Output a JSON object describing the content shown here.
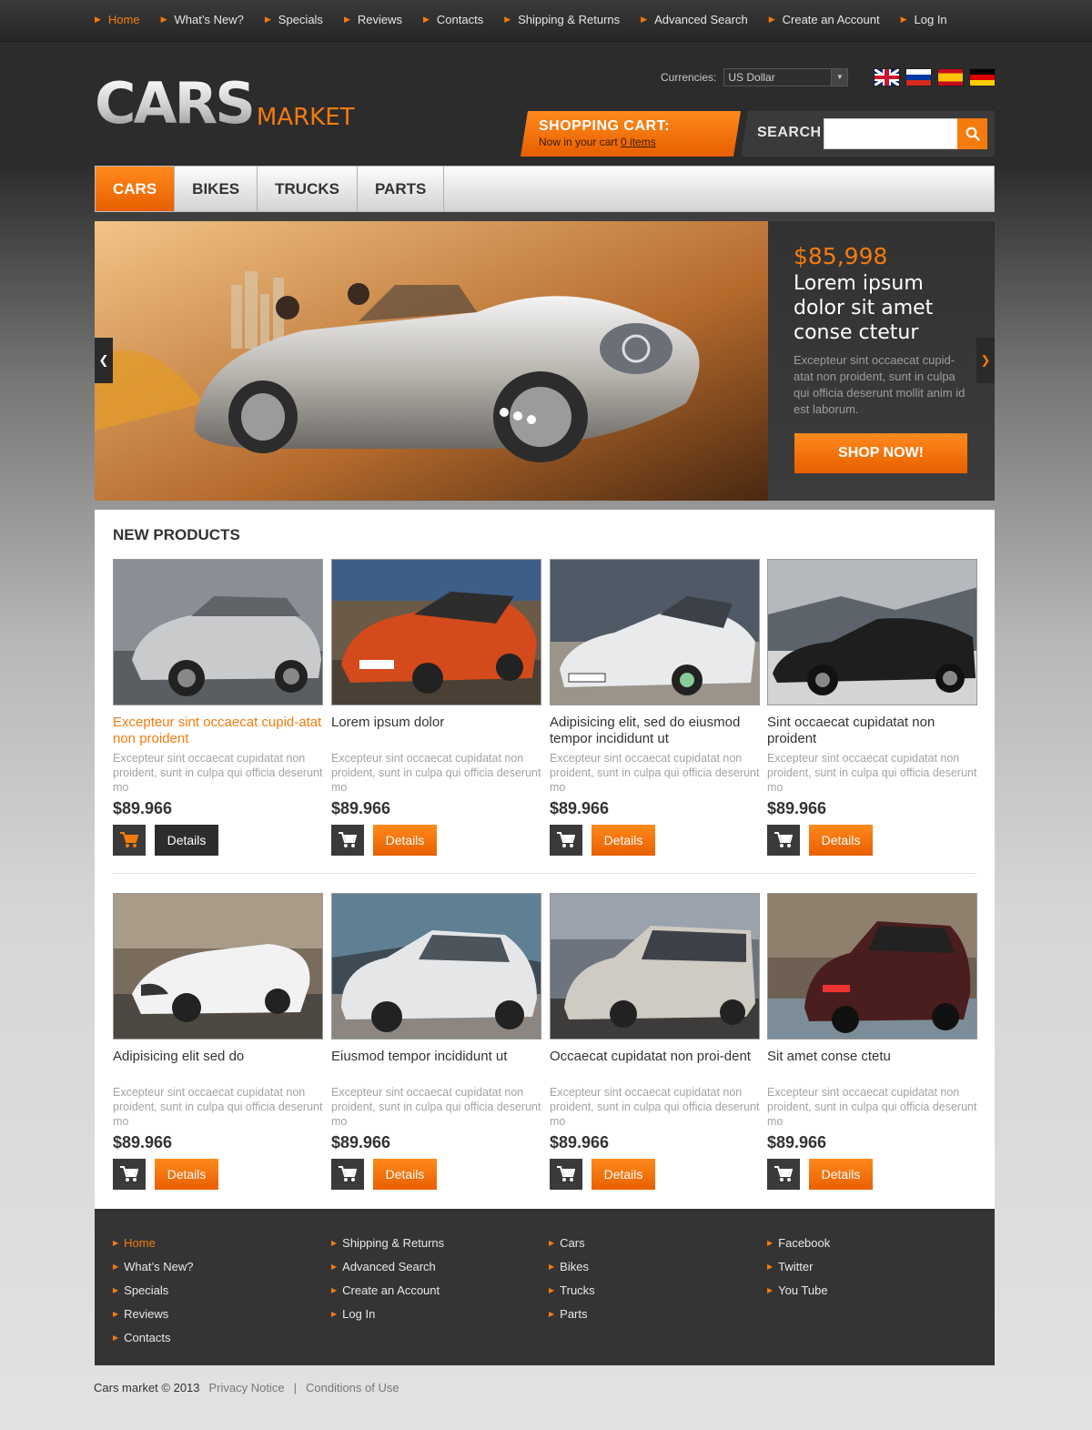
{
  "top_nav": [
    {
      "label": "Home",
      "active": true
    },
    {
      "label": "What’s New?"
    },
    {
      "label": "Specials"
    },
    {
      "label": "Reviews"
    },
    {
      "label": "Contacts"
    },
    {
      "label": "Shipping & Returns"
    },
    {
      "label": "Advanced Search"
    },
    {
      "label": "Create an Account"
    },
    {
      "label": "Log In"
    }
  ],
  "logo": {
    "main": "CARS",
    "sub": "MARKET"
  },
  "currency": {
    "label": "Currencies:",
    "value": "US Dollar"
  },
  "languages": [
    "uk-flag",
    "russia-flag",
    "spain-flag",
    "germany-flag"
  ],
  "cart": {
    "title": "SHOPPING CART:",
    "text": "Now in your cart",
    "items_link": "0 items"
  },
  "search": {
    "label": "SEARCH",
    "placeholder": ""
  },
  "categories": [
    {
      "label": "CARS",
      "active": true
    },
    {
      "label": "BIKES"
    },
    {
      "label": "TRUCKS"
    },
    {
      "label": "PARTS"
    }
  ],
  "slider": {
    "price": "$85,998",
    "headline": "Lorem ipsum dolor sit amet conse ctetur",
    "description": "Excepteur sint occaecat cupid-atat non proident, sunt in culpa qui officia deserunt mollit anim id est laborum.",
    "button": "SHOP NOW!",
    "prev_icon": "chevron-left-icon",
    "next_icon": "chevron-right-icon"
  },
  "products_section": {
    "title": "NEW PRODUCTS",
    "items": [
      {
        "name": "Excepteur sint occaecat cupid-atat non proident",
        "desc": "Excepteur sint occaecat cupidatat non proident, sunt in culpa qui officia deserunt mo",
        "price": "$89.966",
        "details": "Details"
      },
      {
        "name": "Lorem ipsum dolor",
        "desc": "Excepteur sint occaecat cupidatat non proident, sunt in culpa qui officia deserunt mo",
        "price": "$89.966",
        "details": "Details"
      },
      {
        "name": "Adipisicing elit, sed do eiusmod tempor incididunt ut",
        "desc": "Excepteur sint occaecat cupidatat non proident, sunt in culpa qui officia deserunt mo",
        "price": "$89.966",
        "details": "Details"
      },
      {
        "name": "Sint occaecat cupidatat non proident",
        "desc": "Excepteur sint occaecat cupidatat non proident, sunt in culpa qui officia deserunt mo",
        "price": "$89.966",
        "details": "Details"
      },
      {
        "name": "Adipisicing elit sed do",
        "desc": "Excepteur sint occaecat cupidatat non proident, sunt in culpa qui officia deserunt mo",
        "price": "$89.966",
        "details": "Details"
      },
      {
        "name": "Eiusmod tempor incididunt ut",
        "desc": "Excepteur sint occaecat cupidatat non proident, sunt in culpa qui officia deserunt mo",
        "price": "$89.966",
        "details": "Details"
      },
      {
        "name": "Occaecat cupidatat non proi-dent",
        "desc": "Excepteur sint occaecat cupidatat non proident, sunt in culpa qui officia deserunt mo",
        "price": "$89.966",
        "details": "Details"
      },
      {
        "name": "Sit amet conse ctetu",
        "desc": "Excepteur sint occaecat cupidatat non proident, sunt in culpa qui officia deserunt mo",
        "price": "$89.966",
        "details": "Details"
      }
    ]
  },
  "footer": {
    "col1": [
      "Home",
      "What’s New?",
      "Specials",
      "Reviews",
      "Contacts"
    ],
    "col2": [
      "Shipping & Returns",
      "Advanced Search",
      "Create an Account",
      "Log In"
    ],
    "col3": [
      "Cars",
      "Bikes",
      "Trucks",
      "Parts"
    ],
    "col4": [
      "Facebook",
      "Twitter",
      "You Tube"
    ]
  },
  "bottom": {
    "copyright": "Cars market © 2013",
    "privacy": "Privacy Notice",
    "separator": "|",
    "conditions": "Conditions of Use"
  },
  "colors": {
    "accent": "#f57b0d",
    "dark": "#343434"
  }
}
